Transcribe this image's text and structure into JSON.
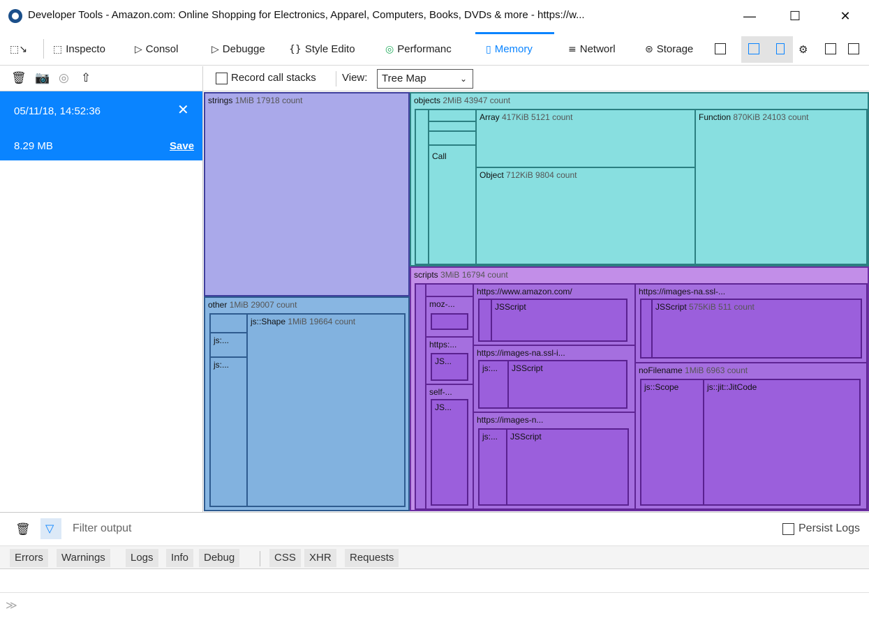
{
  "window": {
    "title": "Developer Tools - Amazon.com: Online Shopping for Electronics, Apparel, Computers, Books, DVDs & more - https://w...",
    "minimize": "—",
    "maximize": "☐",
    "close": "✕"
  },
  "toolbar": {
    "tabs": [
      {
        "label": "Inspecto",
        "icon": "⬚"
      },
      {
        "label": "Consol",
        "icon": "▷"
      },
      {
        "label": "Debugge",
        "icon": "▷"
      },
      {
        "label": "Style Edito",
        "icon": "{}"
      },
      {
        "label": "Performanc",
        "icon": "◎"
      },
      {
        "label": "Memory",
        "icon": "▯"
      },
      {
        "label": "Networl",
        "icon": "≡"
      },
      {
        "label": "Storage",
        "icon": "⊜"
      }
    ],
    "active_tab": "Memory",
    "accent": "#0a84ff"
  },
  "memory": {
    "record_call_stacks": "Record call stacks",
    "view_label": "View:",
    "view_value": "Tree Map"
  },
  "snapshot": {
    "time": "05/11/18, 14:52:36",
    "size": "8.29 MB",
    "save": "Save",
    "close": "✕"
  },
  "treemap": {
    "strings": {
      "name": "strings",
      "meta": "1MiB 17918 count"
    },
    "objects": {
      "name": "objects",
      "meta": "2MiB 43947 count"
    },
    "call": {
      "name": "Call"
    },
    "array": {
      "name": "Array",
      "meta": "417KiB 5121 count"
    },
    "function": {
      "name": "Function",
      "meta": "870KiB 24103 count"
    },
    "object": {
      "name": "Object",
      "meta": "712KiB 9804 count"
    },
    "other": {
      "name": "other",
      "meta": "1MiB 29007 count"
    },
    "shape": {
      "name": "js::Shape",
      "meta": "1MiB 19664 count"
    },
    "js1": {
      "name": "js:..."
    },
    "js2": {
      "name": "js:..."
    },
    "scripts": {
      "name": "scripts",
      "meta": "3MiB 16794 count"
    },
    "moz": {
      "name": "moz-..."
    },
    "https_short": {
      "name": "https:..."
    },
    "js_short": {
      "name": "JS..."
    },
    "self": {
      "name": "self-..."
    },
    "js_short2": {
      "name": "JS..."
    },
    "amazon": {
      "name": "https://www.amazon.com/"
    },
    "amazon_js": {
      "name": "JSScript"
    },
    "imgssl_i": {
      "name": "https://images-na.ssl-i..."
    },
    "imgssl_i_js1": {
      "name": "js:..."
    },
    "imgssl_i_js2": {
      "name": "JSScript"
    },
    "imgs_n": {
      "name": "https://images-n..."
    },
    "imgs_n_js1": {
      "name": "js:..."
    },
    "imgs_n_js2": {
      "name": "JSScript"
    },
    "imgssl": {
      "name": "https://images-na.ssl-..."
    },
    "imgssl_js": {
      "name": "JSScript",
      "meta": "575KiB 511 count"
    },
    "nofilename": {
      "name": "noFilename",
      "meta": "1MiB 6963 count"
    },
    "scope": {
      "name": "js::Scope"
    },
    "jitcode": {
      "name": "js::jit::JitCode"
    }
  },
  "console": {
    "filter_placeholder": "Filter output",
    "persist_logs": "Persist Logs",
    "filters": [
      "Errors",
      "Warnings",
      "Logs",
      "Info",
      "Debug",
      "CSS",
      "XHR",
      "Requests"
    ],
    "prompt": "≫"
  }
}
